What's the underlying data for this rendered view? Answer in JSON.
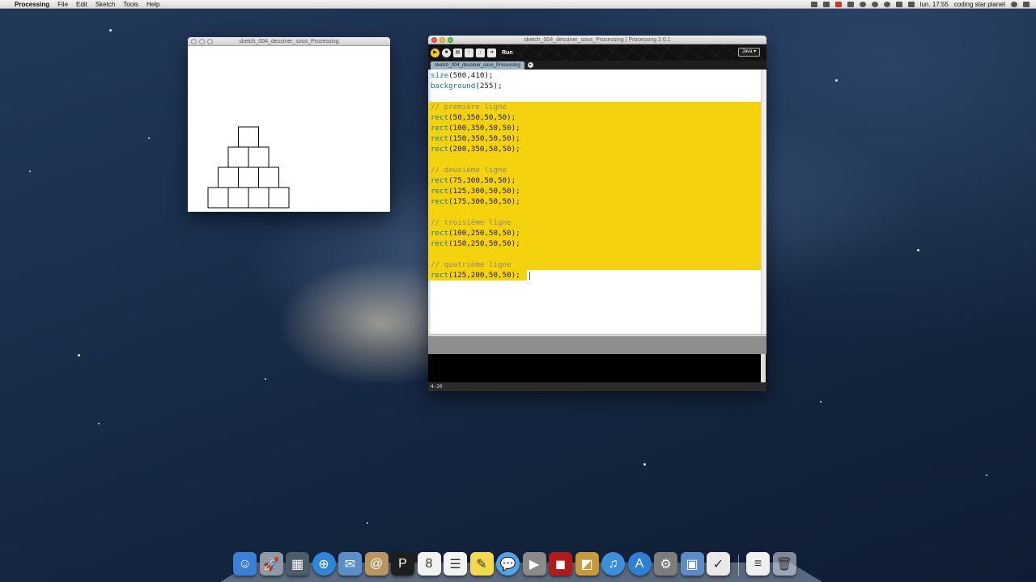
{
  "menubar": {
    "apple_glyph": "",
    "app_name": "Processing",
    "menus": [
      "File",
      "Edit",
      "Sketch",
      "Tools",
      "Help"
    ],
    "clock": "lun. 17:55",
    "user": "coding star planet"
  },
  "sketch_window": {
    "title": "sketch_004_dessiner_sous_Processing",
    "canvas_background": "#ffffff",
    "stroke_color": "#000000",
    "shape_fill": "#ffffff"
  },
  "ide_window": {
    "title": "sketch_004_dessiner_sous_Processing | Processing 2.0.1",
    "run_label": "Run",
    "mode": "Java ▾",
    "tab_label": "sketch_004_dessiner_sous_Processing",
    "status_line": "4-20",
    "highlight_color": "#f5d20e",
    "code_lines": [
      {
        "kw": "size",
        "rest": "(500,410);"
      },
      {
        "kw": "background",
        "rest": "(255);"
      },
      {
        "kw": "",
        "rest": ""
      },
      {
        "cm": "// première ligne"
      },
      {
        "kw": "rect",
        "rest": "(50,350,50,50);"
      },
      {
        "kw": "rect",
        "rest": "(100,350,50,50);"
      },
      {
        "kw": "rect",
        "rest": "(150,350,50,50);"
      },
      {
        "kw": "rect",
        "rest": "(200,350,50,50);"
      },
      {
        "kw": "",
        "rest": ""
      },
      {
        "cm": "// deuxième ligne"
      },
      {
        "kw": "rect",
        "rest": "(75,300,50,50);"
      },
      {
        "kw": "rect",
        "rest": "(125,300,50,50);"
      },
      {
        "kw": "rect",
        "rest": "(175,300,50,50);"
      },
      {
        "kw": "",
        "rest": ""
      },
      {
        "cm": "// troisième ligne"
      },
      {
        "kw": "rect",
        "rest": "(100,250,50,50);"
      },
      {
        "kw": "rect",
        "rest": "(150,250,50,50);"
      },
      {
        "kw": "",
        "rest": ""
      },
      {
        "cm": "// quatrième ligne"
      },
      {
        "kw": "rect",
        "rest": "(125,200,50,50);"
      }
    ]
  },
  "dock": {
    "icons": [
      {
        "name": "finder-icon",
        "glyph": "☺",
        "color": "#3b7fd6"
      },
      {
        "name": "launchpad-icon",
        "glyph": "🚀",
        "color": "#8f9aa6"
      },
      {
        "name": "mission-control-icon",
        "glyph": "▦",
        "color": "#4d5c6b"
      },
      {
        "name": "safari-icon",
        "glyph": "⊕",
        "color": "#2f86d6"
      },
      {
        "name": "mail-icon",
        "glyph": "✉",
        "color": "#5b8dc9"
      },
      {
        "name": "contacts-icon",
        "glyph": "@",
        "color": "#b99660"
      },
      {
        "name": "processing-icon",
        "glyph": "P",
        "color": "#1e1e1e"
      },
      {
        "name": "calendar-icon",
        "glyph": "8",
        "color": "#f2f2f2"
      },
      {
        "name": "reminders-icon",
        "glyph": "☰",
        "color": "#f3f3f3"
      },
      {
        "name": "notes-icon",
        "glyph": "✎",
        "color": "#f2d94e"
      },
      {
        "name": "messages-icon",
        "glyph": "💬",
        "color": "#4fa3e8"
      },
      {
        "name": "facetime-icon",
        "glyph": "▶",
        "color": "#8a8a8a"
      },
      {
        "name": "photo-booth-icon",
        "glyph": "◼",
        "color": "#b01b1b"
      },
      {
        "name": "iphoto-icon",
        "glyph": "◩",
        "color": "#c79a3a"
      },
      {
        "name": "itunes-icon",
        "glyph": "♫",
        "color": "#3c8fdb"
      },
      {
        "name": "app-store-icon",
        "glyph": "A",
        "color": "#2f7fd6"
      },
      {
        "name": "system-preferences-icon",
        "glyph": "⚙",
        "color": "#7d7d7d"
      },
      {
        "name": "screenshots-icon",
        "glyph": "▣",
        "color": "#5d8bc7"
      },
      {
        "name": "preview-icon",
        "glyph": "✓",
        "color": "#e9e9e9"
      }
    ],
    "documents_glyph": "≡",
    "trash_glyph": "🗑"
  }
}
